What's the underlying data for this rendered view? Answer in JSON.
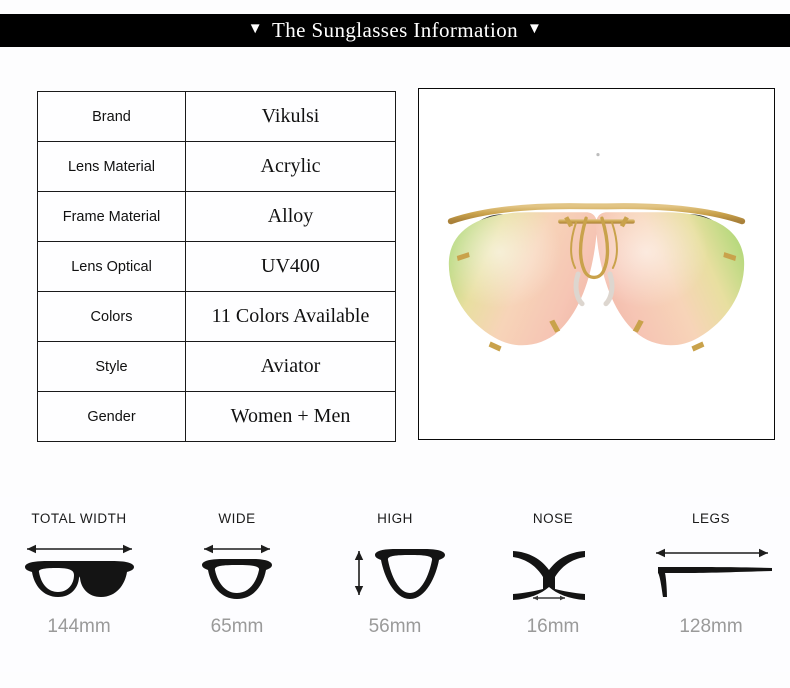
{
  "header": {
    "title": "The Sunglasses Information",
    "left_marker": "▼",
    "right_marker": "▼"
  },
  "spec_table": {
    "rows": [
      {
        "label": "Brand",
        "value": "Vikulsi"
      },
      {
        "label": "Lens Material",
        "value": "Acrylic"
      },
      {
        "label": "Frame Material",
        "value": "Alloy"
      },
      {
        "label": "Lens Optical",
        "value": "UV400"
      },
      {
        "label": "Colors",
        "value": "11 Colors Available"
      },
      {
        "label": "Style",
        "value": "Aviator"
      },
      {
        "label": "Gender",
        "value": "Women + Men"
      }
    ]
  },
  "product_image": {
    "alt": "rimless aviator sunglasses with pink mirrored gradient lenses and gold metal frame",
    "frame_color": "#c9a24b",
    "lens_center_color": "#f7c9b6",
    "lens_edge_color": "#bcd88a",
    "temple_tip_color": "#3a3a3a"
  },
  "measurements": [
    {
      "label": "TOTAL WIDTH",
      "value": "144mm",
      "icon": "full-frame-width-icon"
    },
    {
      "label": "WIDE",
      "value": "65mm",
      "icon": "single-lens-width-icon"
    },
    {
      "label": "HIGH",
      "value": "56mm",
      "icon": "single-lens-height-icon"
    },
    {
      "label": "NOSE",
      "value": "16mm",
      "icon": "nose-bridge-icon"
    },
    {
      "label": "LEGS",
      "value": "128mm",
      "icon": "temple-arm-icon"
    }
  ]
}
